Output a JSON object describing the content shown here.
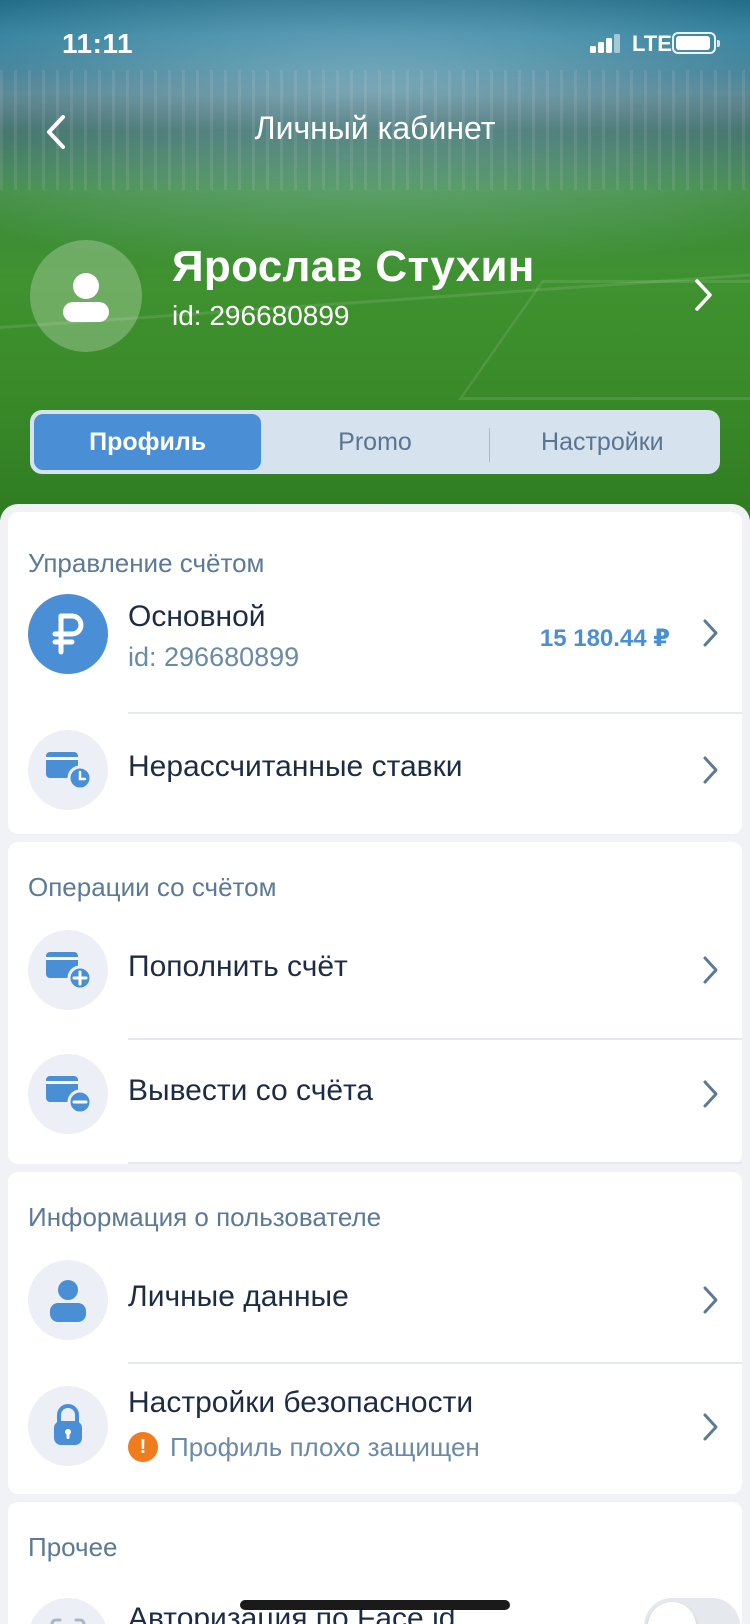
{
  "status_bar": {
    "time": "11:11",
    "network": "LTE"
  },
  "nav": {
    "title": "Личный кабинет"
  },
  "profile": {
    "name": "Ярослав Стухин",
    "id": "id: 296680899"
  },
  "tabs": [
    {
      "label": "Профиль",
      "active": true
    },
    {
      "label": "Promo",
      "active": false
    },
    {
      "label": "Настройки",
      "active": false
    }
  ],
  "account_management": {
    "title": "Управление счётом",
    "main_account": {
      "label": "Основной",
      "id": "id: 296680899",
      "balance": "15 180.44 ₽"
    },
    "unsettled_bets": {
      "label": "Нерассчитанные ставки"
    }
  },
  "account_operations": {
    "title": "Операции со счётом",
    "deposit": {
      "label": "Пополнить счёт"
    },
    "withdraw": {
      "label": "Вывести со счёта"
    }
  },
  "user_info": {
    "title": "Информация о пользователе",
    "personal_data": {
      "label": "Личные данные"
    },
    "security": {
      "label": "Настройки безопасности",
      "warning": "Профиль плохо защищен",
      "warning_icon": "!"
    }
  },
  "other": {
    "title": "Прочее",
    "face_id": {
      "label": "Авторизация по Face id",
      "enabled": false
    }
  },
  "colors": {
    "accent": "#4a8fd6",
    "warning": "#f07c1d",
    "text": "#1d2c44",
    "muted": "#6a8aa8"
  }
}
